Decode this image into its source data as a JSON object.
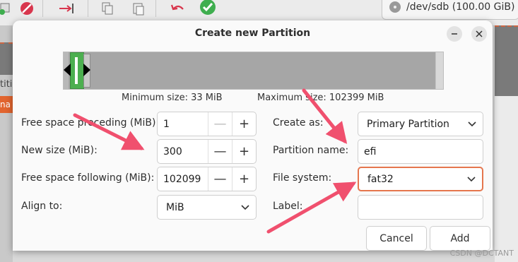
{
  "background": {
    "device_label": "/dev/sdb (100.00 GiB)",
    "left_partial_text": "titi",
    "left_orange_text": "na"
  },
  "dialog": {
    "title": "Create new Partition",
    "size_info": {
      "minimum": "Minimum size: 33 MiB",
      "maximum": "Maximum size: 102399 MiB"
    },
    "fields": {
      "free_preceding": {
        "label": "Free space preceding (MiB):",
        "value": "1"
      },
      "new_size": {
        "label": "New size (MiB):",
        "value": "300"
      },
      "free_following": {
        "label": "Free space following (MiB):",
        "value": "102099"
      },
      "align_to": {
        "label": "Align to:",
        "value": "MiB"
      },
      "create_as": {
        "label": "Create as:",
        "value": "Primary Partition"
      },
      "partition_name": {
        "label": "Partition name:",
        "value": "efi"
      },
      "file_system": {
        "label": "File system:",
        "value": "fat32"
      },
      "label": {
        "label": "Label:",
        "value": ""
      }
    },
    "buttons": {
      "cancel": "Cancel",
      "add": "Add"
    }
  },
  "glyphs": {
    "minus": "—",
    "plus": "+"
  },
  "watermark": "CSDN @DCTANT",
  "colors": {
    "partition_green": "#4caf50",
    "focus_border": "#e5764e",
    "annotation_arrow": "#f0506e",
    "toolbar_delete_red": "#d8364d",
    "toolbar_apply_green": "#3fae4f"
  }
}
